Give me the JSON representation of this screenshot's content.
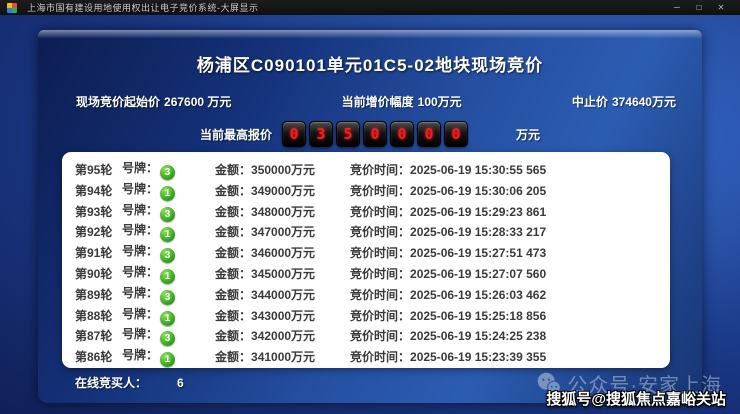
{
  "window": {
    "title": "上海市国有建设用地使用权出让电子竞价系统-大屏显示",
    "controls": {
      "minimize": "—",
      "maximize": "☐",
      "close": "✕"
    }
  },
  "header": {
    "title": "杨浦区C090101单元01C5-02地块现场竞价"
  },
  "auction_info": {
    "start_price_label": "现场竞价起始价",
    "start_price_value": "267600 万元",
    "increment_label": "当前增价幅度",
    "increment_value": "100万元",
    "cutoff_label": "中止价",
    "cutoff_value": "374640万元"
  },
  "highest_bid": {
    "label": "当前最高报价",
    "digits": [
      "0",
      "3",
      "5",
      "0",
      "0",
      "0",
      "0"
    ],
    "unit": "万元"
  },
  "bids": [
    {
      "round": "第95轮",
      "bidder_label": "号牌：",
      "bidder": "3",
      "amount_label": "金额：",
      "amount": "350000万元",
      "time_label": "竞价时间：",
      "time": "2025-06-19 15:30:55 565"
    },
    {
      "round": "第94轮",
      "bidder_label": "号牌：",
      "bidder": "1",
      "amount_label": "金额：",
      "amount": "349000万元",
      "time_label": "竞价时间：",
      "time": "2025-06-19 15:30:06 205"
    },
    {
      "round": "第93轮",
      "bidder_label": "号牌：",
      "bidder": "3",
      "amount_label": "金额：",
      "amount": "348000万元",
      "time_label": "竞价时间：",
      "time": "2025-06-19 15:29:23 861"
    },
    {
      "round": "第92轮",
      "bidder_label": "号牌：",
      "bidder": "1",
      "amount_label": "金额：",
      "amount": "347000万元",
      "time_label": "竞价时间：",
      "time": "2025-06-19 15:28:33 217"
    },
    {
      "round": "第91轮",
      "bidder_label": "号牌：",
      "bidder": "3",
      "amount_label": "金额：",
      "amount": "346000万元",
      "time_label": "竞价时间：",
      "time": "2025-06-19 15:27:51 473"
    },
    {
      "round": "第90轮",
      "bidder_label": "号牌：",
      "bidder": "1",
      "amount_label": "金额：",
      "amount": "345000万元",
      "time_label": "竞价时间：",
      "time": "2025-06-19 15:27:07 560"
    },
    {
      "round": "第89轮",
      "bidder_label": "号牌：",
      "bidder": "3",
      "amount_label": "金额：",
      "amount": "344000万元",
      "time_label": "竞价时间：",
      "time": "2025-06-19 15:26:03 462"
    },
    {
      "round": "第88轮",
      "bidder_label": "号牌：",
      "bidder": "1",
      "amount_label": "金额：",
      "amount": "343000万元",
      "time_label": "竞价时间：",
      "time": "2025-06-19 15:25:18 856"
    },
    {
      "round": "第87轮",
      "bidder_label": "号牌：",
      "bidder": "3",
      "amount_label": "金额：",
      "amount": "342000万元",
      "time_label": "竞价时间：",
      "time": "2025-06-19 15:24:25 238"
    },
    {
      "round": "第86轮",
      "bidder_label": "号牌：",
      "bidder": "1",
      "amount_label": "金额：",
      "amount": "341000万元",
      "time_label": "竞价时间：",
      "time": "2025-06-19 15:23:39 355"
    }
  ],
  "footer": {
    "online_label": "在线竞买人：",
    "online_count": "6"
  },
  "watermarks": {
    "wechat_text": "公众号·安家上海",
    "sohu_text": "搜狐号@搜狐焦点嘉峪关站"
  },
  "colors": {
    "digit_red": "#ff1a1a",
    "badge_green": "#35a81e",
    "panel_blue": "#2c5cb2",
    "table_bg": "#ffffff"
  }
}
